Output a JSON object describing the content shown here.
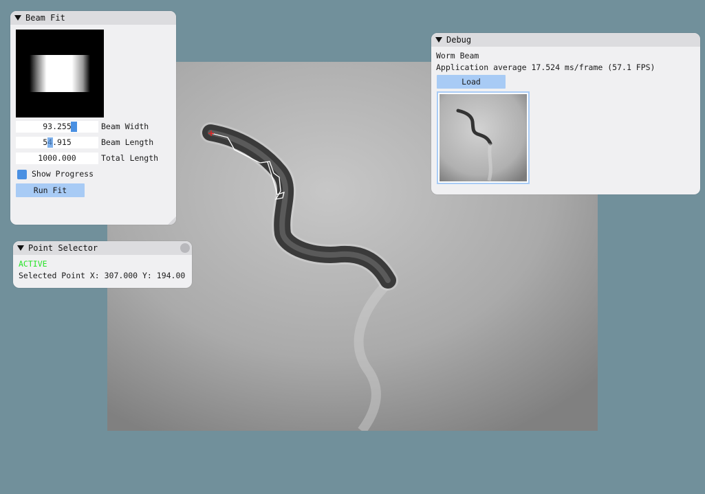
{
  "beam_fit": {
    "title": "Beam Fit",
    "fields": [
      {
        "value": "93.255",
        "label": "Beam Width"
      },
      {
        "value": "54.915",
        "label": "Beam Length"
      },
      {
        "value": "1000.000",
        "label": "Total Length"
      }
    ],
    "show_progress_label": "Show Progress",
    "show_progress_checked": true,
    "run_fit_label": "Run Fit"
  },
  "point_selector": {
    "title": "Point Selector",
    "status": "ACTIVE",
    "selected_point_text": "Selected Point X: 307.000  Y: 194.00"
  },
  "debug": {
    "title": "Debug",
    "heading": "Worm Beam",
    "perf_text": "Application average 17.524 ms/frame (57.1 FPS)",
    "load_label": "Load"
  },
  "colors": {
    "background": "#71909b",
    "window_bg": "#f0f0f2",
    "title_bar": "#dcdcdf",
    "button": "#a8cbf5",
    "accent_blue": "#4a90e2",
    "active_green": "#27e327",
    "marker_red": "#e02020"
  }
}
